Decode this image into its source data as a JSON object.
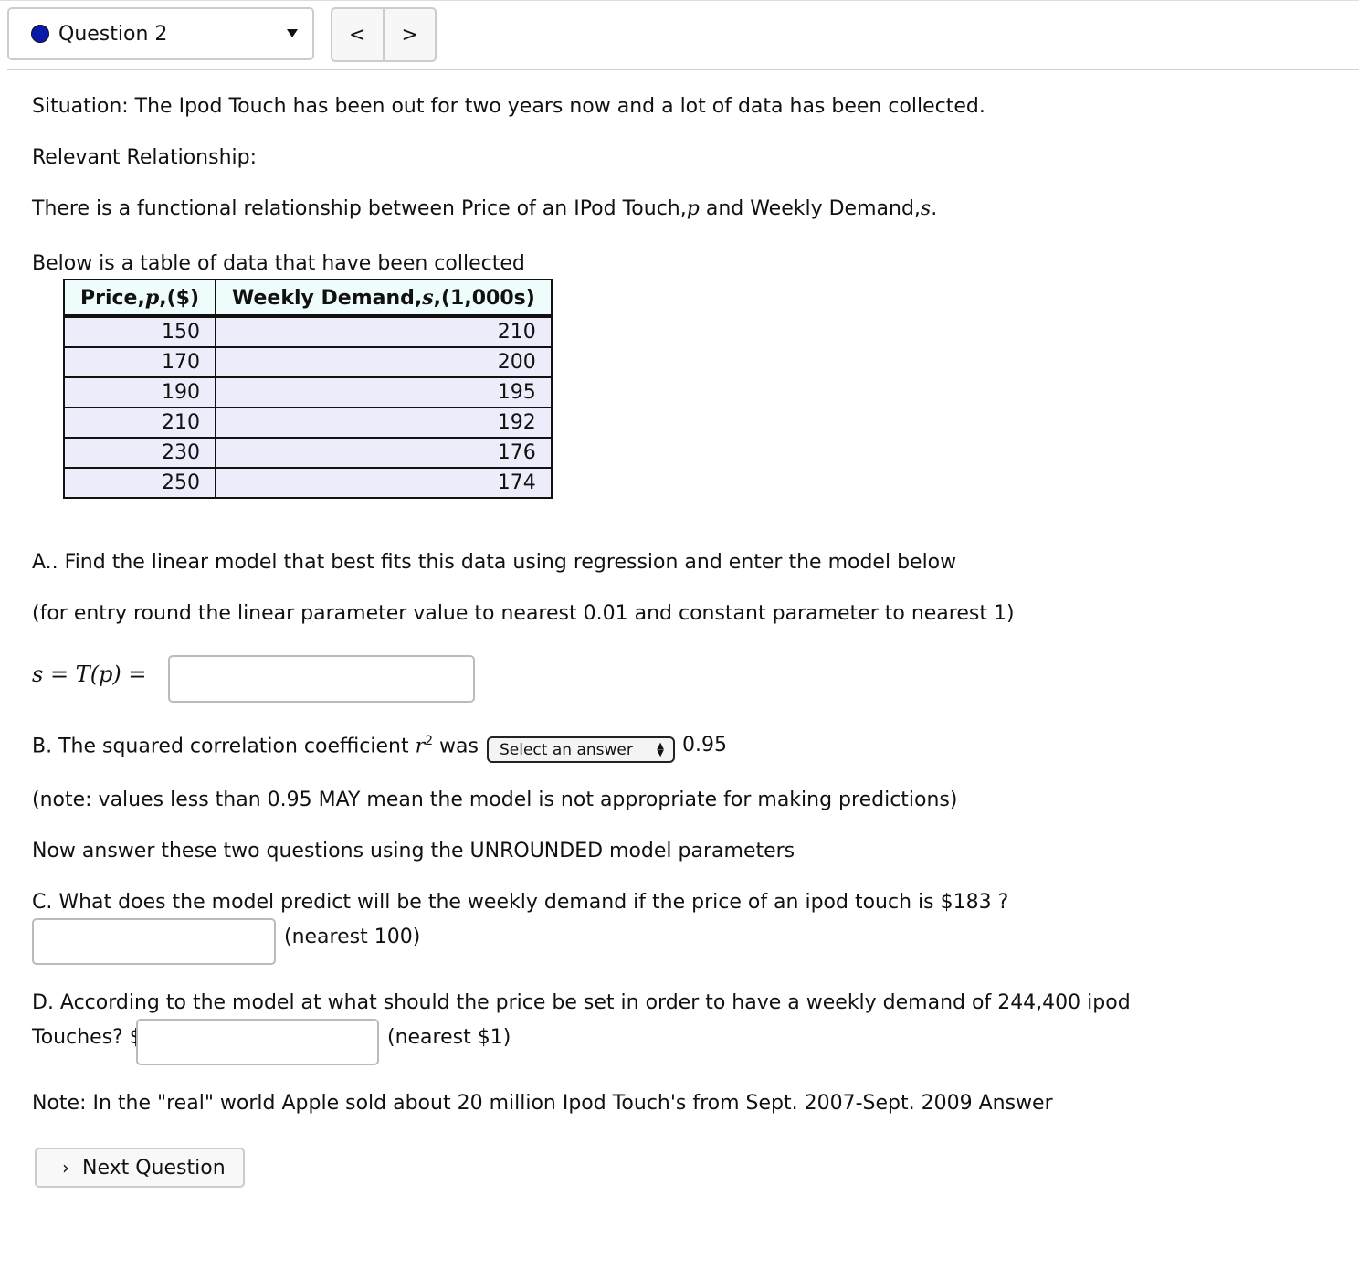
{
  "header": {
    "question_selector": {
      "label": "Question 2",
      "status_color": "#0a1aa8"
    },
    "prev_label": "<",
    "next_label": ">"
  },
  "content": {
    "situation": "Situation: The Ipod Touch has been out for two years now and a lot of data has been collected.",
    "relevant": "Relevant Relationship:",
    "relationship_prefix": "There is a functional relationship between Price of an IPod Touch,",
    "relationship_var1": "p",
    "relationship_mid": " and Weekly Demand,",
    "relationship_var2": "s",
    "relationship_end": ".",
    "table_caption": "Below is a table of data that have been collected",
    "table": {
      "headers": [
        {
          "pre": "Price,",
          "var": "p",
          "post": ",($)"
        },
        {
          "pre": "Weekly Demand,",
          "var": "s",
          "post": ",(1,000s)"
        }
      ],
      "rows": [
        [
          "150",
          "210"
        ],
        [
          "170",
          "200"
        ],
        [
          "190",
          "195"
        ],
        [
          "210",
          "192"
        ],
        [
          "230",
          "176"
        ],
        [
          "250",
          "174"
        ]
      ]
    },
    "partA": "A.. Find the linear model that best fits this data using regression and enter the model below",
    "partA_note": "(for entry round the linear parameter value to nearest 0.01 and constant parameter to nearest 1)",
    "model_label": "s = T(p) =",
    "model_value": "",
    "partB_prefix": "B. The squared correlation coefficient ",
    "partB_var": "r",
    "partB_sup": "2",
    "partB_was": " was",
    "partB_select": "Select an answer",
    "partB_value": "0.95",
    "partB_note": "(note: values less than 0.95 MAY mean the model is not appropriate for making predictions)",
    "unrounded_note": "Now answer these two questions using the UNROUNDED model parameters",
    "partC": "C. What does the model predict will be the weekly demand if the price of an ipod touch is $183 ?",
    "partC_value": "",
    "partC_unit": "(nearest 100)",
    "partD": "D. According to the model at what should the price be set in order to have a weekly demand of 244,400 ipod",
    "partD_line2": "Touches? $",
    "partD_value": "",
    "partD_unit": "(nearest $1)",
    "final_note": "Note: In the \"real\" world Apple sold about 20 million Ipod Touch's from Sept. 2007-Sept. 2009 Answer"
  },
  "footer": {
    "next_question": "Next Question"
  }
}
